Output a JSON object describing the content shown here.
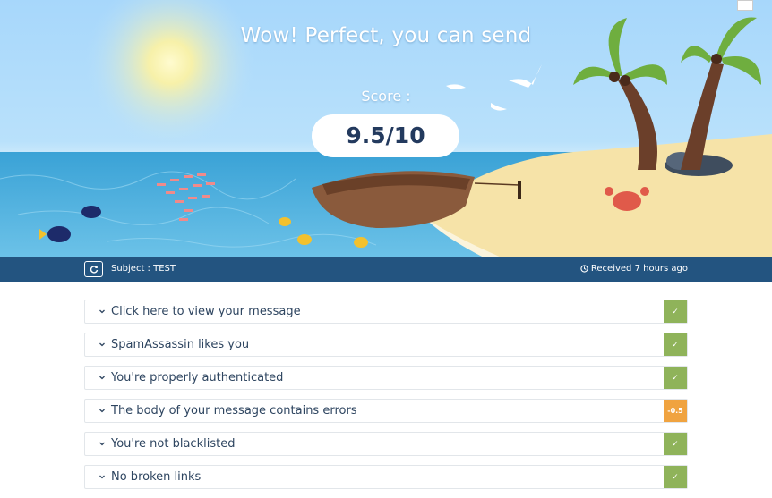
{
  "hero": {
    "headline": "Wow! Perfect, you can send",
    "score_label": "Score :",
    "score_value": "9.5/10"
  },
  "language_flag": "uk-flag-icon",
  "infobar": {
    "refresh_icon": "refresh-icon",
    "subject": "Subject : TEST",
    "received_icon": "clock-icon",
    "received": "Received 7 hours ago"
  },
  "colors": {
    "bar": "#235480",
    "ok": "#8fb35a",
    "warn": "#f0a340",
    "score_text": "#233a5e"
  },
  "results": [
    {
      "label": "Click here to view your message",
      "status": "ok",
      "badge": "✓"
    },
    {
      "label": "SpamAssassin likes you",
      "status": "ok",
      "badge": "✓"
    },
    {
      "label": "You're properly authenticated",
      "status": "ok",
      "badge": "✓"
    },
    {
      "label": "The body of your message contains errors",
      "status": "warn",
      "badge": "-0.5"
    },
    {
      "label": "You're not blacklisted",
      "status": "ok",
      "badge": "✓"
    },
    {
      "label": "No broken links",
      "status": "ok",
      "badge": "✓"
    }
  ]
}
